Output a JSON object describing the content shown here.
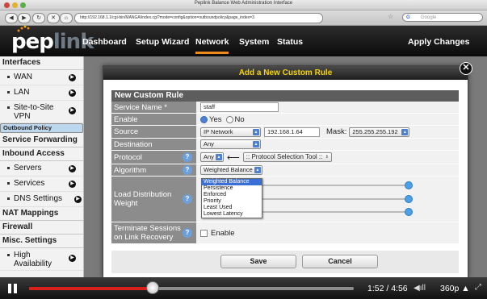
{
  "window": {
    "title": "Peplink Balance Web Administration Interface"
  },
  "browser": {
    "url": "http://192.168.1.1/cgi-bin/MANGA/index.cgi?mode=config&option=outboundpolicy&page_index=3",
    "search_placeholder": "Google"
  },
  "header": {
    "logo_text_1": "pep",
    "logo_text_2": "link",
    "nav": [
      "Dashboard",
      "Setup Wizard",
      "Network",
      "System",
      "Status"
    ],
    "active_nav": "Network",
    "apply_label": "Apply Changes"
  },
  "sidebar": {
    "interfaces_heading": "Interfaces",
    "wan": "WAN",
    "lan": "LAN",
    "site_to_site": "Site-to-Site VPN",
    "outbound_policy": "Outbound Policy",
    "service_forwarding": "Service Forwarding",
    "inbound_access": "Inbound Access",
    "servers": "Servers",
    "services": "Services",
    "dns_settings": "DNS Settings",
    "nat_mappings": "NAT Mappings",
    "firewall": "Firewall",
    "misc_settings": "Misc. Settings",
    "high_availability": "High Availability"
  },
  "dialog": {
    "title": "Add a New Custom Rule",
    "section": "New Custom Rule",
    "service_name_label": "Service Name *",
    "service_name_value": "staff",
    "enable_label": "Enable",
    "enable_yes": "Yes",
    "enable_no": "No",
    "source_label": "Source",
    "source_type": "IP Network",
    "source_ip": "192.168.1.64",
    "mask_label": "Mask:",
    "mask_value": "255.255.255.192",
    "destination_label": "Destination",
    "destination_value": "Any",
    "protocol_label": "Protocol",
    "protocol_value": "Any",
    "protocol_tool": ":: Protocol Selection Tool ::",
    "algorithm_label": "Algorithm",
    "algorithm_value": "Weighted Balance",
    "algorithm_options": [
      "Weighted Balance",
      "Persistence",
      "Enforced",
      "Priority",
      "Least Used",
      "Lowest Latency"
    ],
    "load_distribution_label": "Load Distribution Weight",
    "terminate_label": "Terminate Sessions on Link Recovery",
    "terminate_enable": "Enable",
    "save_label": "Save",
    "cancel_label": "Cancel",
    "help_glyph": "?",
    "close_glyph": "✕"
  },
  "player": {
    "time": "1:52 / 4:56",
    "quality": "360p ▲",
    "progress": 0.378
  },
  "colors": {
    "accent_orange": "#f08a1c",
    "dialog_title": "#f5d300",
    "player_red": "#d9201a",
    "selection_blue": "#3a6fd8"
  }
}
